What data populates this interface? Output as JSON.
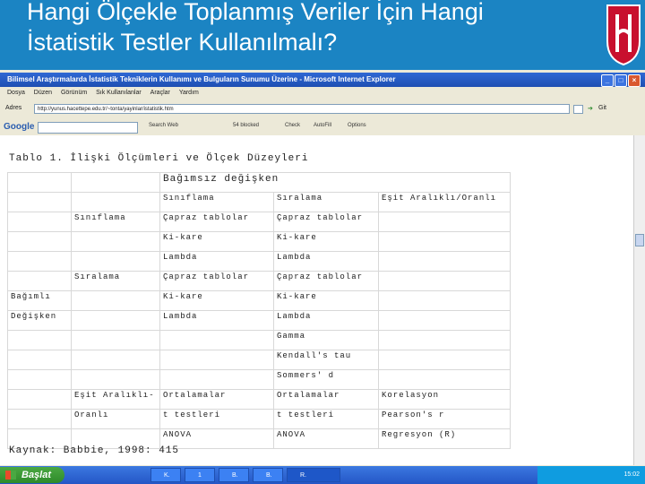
{
  "slide": {
    "title_line1": "Hangi Ölçekle Toplanmış Veriler İçin Hangi",
    "title_line2": "İstatistik Testler Kullanılmalı?"
  },
  "browser": {
    "window_title": "Bilimsel Araştırmalarda İstatistik Tekniklerin Kullanımı ve Bulguların Sunumu Üzerine - Microsoft Internet Explorer",
    "menu": [
      "Dosya",
      "Düzen",
      "Görünüm",
      "Sık Kullanılanlar",
      "Araçlar",
      "Yardım"
    ],
    "address_label": "Adres",
    "address_value": "http://yunus.hacettepe.edu.tr/~tonta/yayinlar/istatistik.htm",
    "go_label": "Git",
    "google": {
      "logo": "Google",
      "search_label": "Search Web",
      "items": [
        "54 blocked",
        "Check",
        "AutoFill",
        "Options"
      ]
    }
  },
  "page": {
    "caption": "Tablo 1. İlişki Ölçümleri ve Ölçek Düzeyleri",
    "source": "Kaynak: Babbie, 1998: 415",
    "table": {
      "header_group": "Bağımsız değişken",
      "subheaders": [
        "Sınıflama",
        "Sıralama",
        "Eşit Aralıklı/Oranlı"
      ],
      "row_label": [
        "Bağımlı",
        "Değişken"
      ],
      "rows": [
        {
          "label": "Sınıflama",
          "c1": "Çapraz tablolar",
          "c2": "Çapraz tablolar",
          "c3": ""
        },
        {
          "label": "",
          "c1": "Ki-kare",
          "c2": "Ki-kare",
          "c3": ""
        },
        {
          "label": "",
          "c1": "Lambda",
          "c2": "Lambda",
          "c3": ""
        },
        {
          "label": "Sıralama",
          "c1": "Çapraz tablolar",
          "c2": "Çapraz tablolar",
          "c3": ""
        },
        {
          "label": "",
          "c1": "Ki-kare",
          "c2": "Ki-kare",
          "c3": ""
        },
        {
          "label": "",
          "c1": "Lambda",
          "c2": "Lambda",
          "c3": ""
        },
        {
          "label": "",
          "c1": "",
          "c2": "Gamma",
          "c3": ""
        },
        {
          "label": "",
          "c1": "",
          "c2": "Kendall's tau",
          "c3": ""
        },
        {
          "label": "",
          "c1": "",
          "c2": "Sommers' d",
          "c3": ""
        },
        {
          "label": "Eşit Aralıklı-",
          "c1": "Ortalamalar",
          "c2": "Ortalamalar",
          "c3": "Korelasyon"
        },
        {
          "label": "Oranlı",
          "c1": "t testleri",
          "c2": "t testleri",
          "c3": "Pearson's r"
        },
        {
          "label": "",
          "c1": "ANOVA",
          "c2": "ANOVA",
          "c3": "Regresyon (R)"
        }
      ]
    }
  },
  "taskbar": {
    "start_label": "Başlat",
    "items": [
      "K.",
      "1",
      "B.",
      "B.",
      "R."
    ],
    "clock": "15:02"
  },
  "colors": {
    "header_blue": "#1b84c3",
    "logo_red": "#c8102e",
    "xp_blue": "#2456c6",
    "start_green": "#3a9a35"
  }
}
